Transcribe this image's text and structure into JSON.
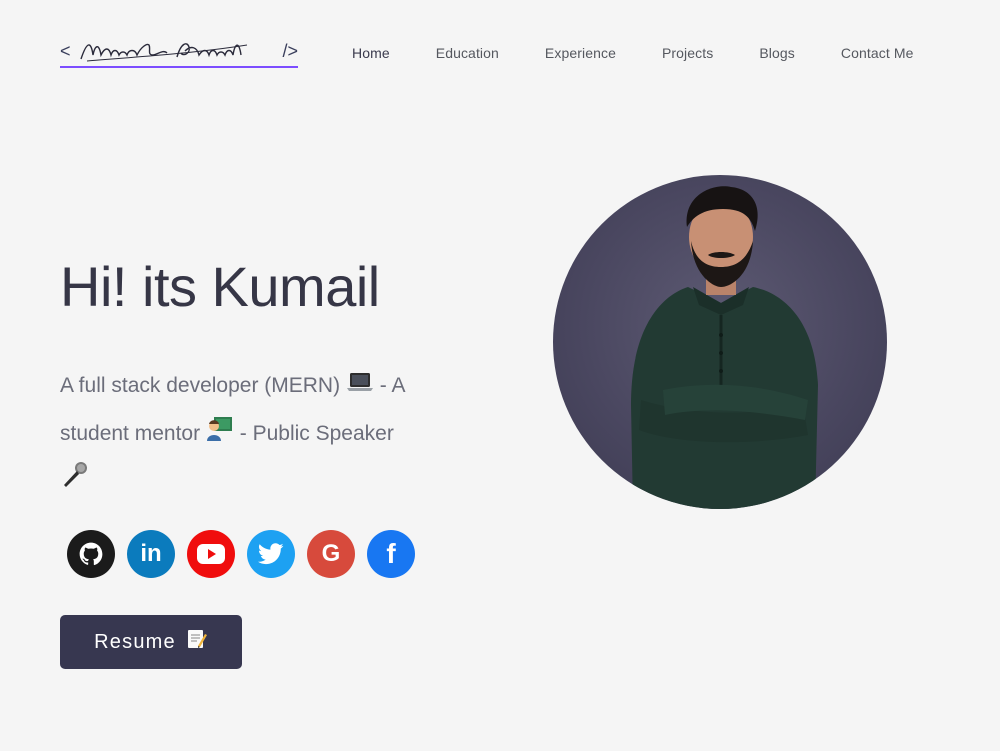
{
  "header": {
    "logo": {
      "open_bracket": "<",
      "signature": "Muhammad Kumail",
      "close_bracket": "/>"
    },
    "nav": [
      {
        "label": "Home",
        "active": true
      },
      {
        "label": "Education",
        "active": false
      },
      {
        "label": "Experience",
        "active": false
      },
      {
        "label": "Projects",
        "active": false
      },
      {
        "label": "Blogs",
        "active": false
      },
      {
        "label": "Contact Me",
        "active": false
      }
    ]
  },
  "hero": {
    "title": "Hi! its Kumail",
    "subtitle_part1": "A full stack developer (MERN) ",
    "subtitle_part2": " - A student mentor ",
    "subtitle_part3": " - Public Speaker",
    "emoji_laptop": "laptop-icon",
    "emoji_mentor": "teacher-icon",
    "emoji_mic": "microphone-icon"
  },
  "socials": [
    {
      "name": "github",
      "icon": "github-icon",
      "color": "#1b1b1b"
    },
    {
      "name": "linkedin",
      "icon": "linkedin-icon",
      "color": "#0b7bbd",
      "glyph": "in"
    },
    {
      "name": "youtube",
      "icon": "youtube-icon",
      "color": "#f00d0d"
    },
    {
      "name": "twitter",
      "icon": "twitter-icon",
      "color": "#1da1f2"
    },
    {
      "name": "google",
      "icon": "google-icon",
      "color": "#d74a3c",
      "glyph": "G"
    },
    {
      "name": "facebook",
      "icon": "facebook-icon",
      "color": "#1877f2",
      "glyph": "f"
    }
  ],
  "resume": {
    "label": "Resume",
    "icon": "memo-icon"
  },
  "portrait": {
    "icon": "profile-photo"
  },
  "colors": {
    "background": "#f5f5f5",
    "accent": "#7c4dff",
    "button": "#373750",
    "heading": "#363646"
  }
}
